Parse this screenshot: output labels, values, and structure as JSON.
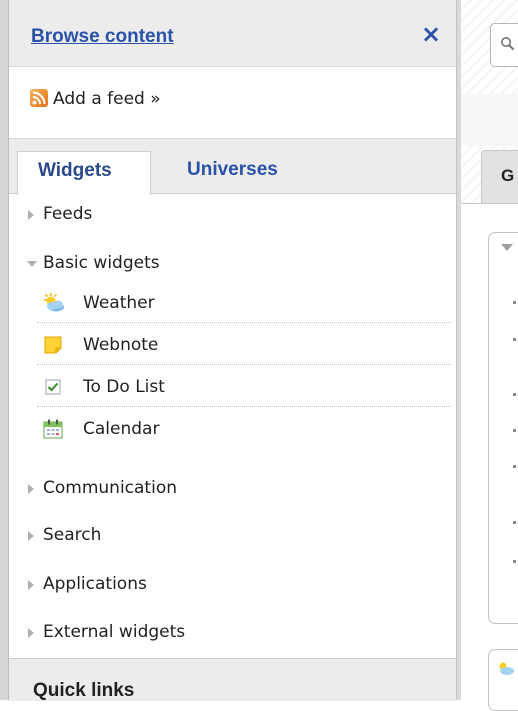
{
  "panel": {
    "title": "Browse content",
    "close_label": "×",
    "add_feed_label": "Add a feed »",
    "tabs": [
      {
        "label": "Widgets",
        "active": true
      },
      {
        "label": "Universes",
        "active": false
      }
    ],
    "categories": {
      "feeds": {
        "label": "Feeds",
        "expanded": false
      },
      "basic": {
        "label": "Basic widgets",
        "expanded": true,
        "items": [
          {
            "label": "Weather",
            "icon": "weather-icon"
          },
          {
            "label": "Webnote",
            "icon": "note-icon"
          },
          {
            "label": "To Do List",
            "icon": "checkbox-icon"
          },
          {
            "label": "Calendar",
            "icon": "calendar-icon"
          }
        ]
      },
      "communication": {
        "label": "Communication",
        "expanded": false
      },
      "search": {
        "label": "Search",
        "expanded": false
      },
      "applications": {
        "label": "Applications",
        "expanded": false
      },
      "external": {
        "label": "External widgets",
        "expanded": false
      }
    },
    "quick_links_label": "Quick links"
  },
  "right": {
    "tab_partial_label": "G"
  },
  "colors": {
    "link": "#2a52a8",
    "panel_gray": "#ececec",
    "rss": "#e2741c"
  }
}
